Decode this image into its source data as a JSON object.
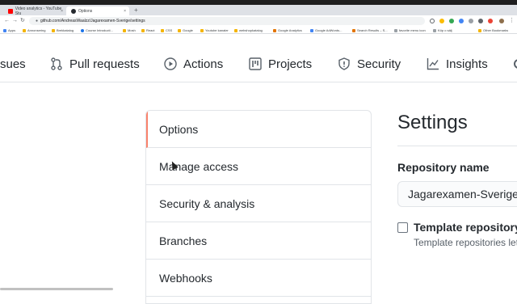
{
  "browser": {
    "tabs": [
      {
        "title": "Video analytics - YouTube Stu",
        "active": false,
        "favicon_color": "#ff0000"
      },
      {
        "title": "Options",
        "active": true,
        "favicon_color": "#24292e"
      }
    ],
    "close_glyph": "×",
    "new_tab_glyph": "+",
    "nav": {
      "back": "←",
      "forward": "→",
      "reload": "↻"
    },
    "url": "github.com/AndreasWaalzz/Jagarexamen-Sverige/settings",
    "bookmarks": [
      {
        "label": "Apps",
        "color": "#4285f4"
      },
      {
        "label": "Annonsering",
        "color": "#f4b400"
      },
      {
        "label": "Brekkatalog",
        "color": "#f4b400"
      },
      {
        "label": "Course Introducti...",
        "color": "#1a73e8"
      },
      {
        "label": "Mosh",
        "color": "#f4b400"
      },
      {
        "label": "React",
        "color": "#f4b400"
      },
      {
        "label": "CSS",
        "color": "#f4b400"
      },
      {
        "label": "Google",
        "color": "#f4b400"
      },
      {
        "label": "Youtube kanaler",
        "color": "#f4b400"
      },
      {
        "label": "webshopkatalog",
        "color": "#f4b400"
      },
      {
        "label": "Google Analytics",
        "color": "#e37400"
      },
      {
        "label": "Google AdWords...",
        "color": "#4285f4"
      },
      {
        "label": "Search Results – S...",
        "color": "#e37400"
      },
      {
        "label": "favorite menu icon",
        "color": "#9aa0a6"
      },
      {
        "label": "Köp o sälj",
        "color": "#9aa0a6"
      },
      {
        "label": "Other Bookmarks",
        "color": "#f4b400"
      }
    ]
  },
  "repo_nav": {
    "items": [
      {
        "label": "sues",
        "icon": "issues-icon"
      },
      {
        "label": "Pull requests",
        "icon": "pull-request-icon"
      },
      {
        "label": "Actions",
        "icon": "play-icon"
      },
      {
        "label": "Projects",
        "icon": "project-icon"
      },
      {
        "label": "Security",
        "icon": "shield-icon"
      },
      {
        "label": "Insights",
        "icon": "graph-icon"
      }
    ]
  },
  "settings_menu": {
    "items": [
      {
        "label": "Options",
        "selected": true
      },
      {
        "label": "Manage access",
        "selected": false
      },
      {
        "label": "Security & analysis",
        "selected": false
      },
      {
        "label": "Branches",
        "selected": false
      },
      {
        "label": "Webhooks",
        "selected": false
      }
    ]
  },
  "main": {
    "title": "Settings",
    "repo_name_label": "Repository name",
    "repo_name_value": "Jagarexamen-Sverige",
    "template_label": "Template repository",
    "template_desc": "Template repositories let"
  },
  "colors": {
    "accent_selected": "#f9826c",
    "border": "#e1e4e8",
    "text": "#24292e"
  }
}
